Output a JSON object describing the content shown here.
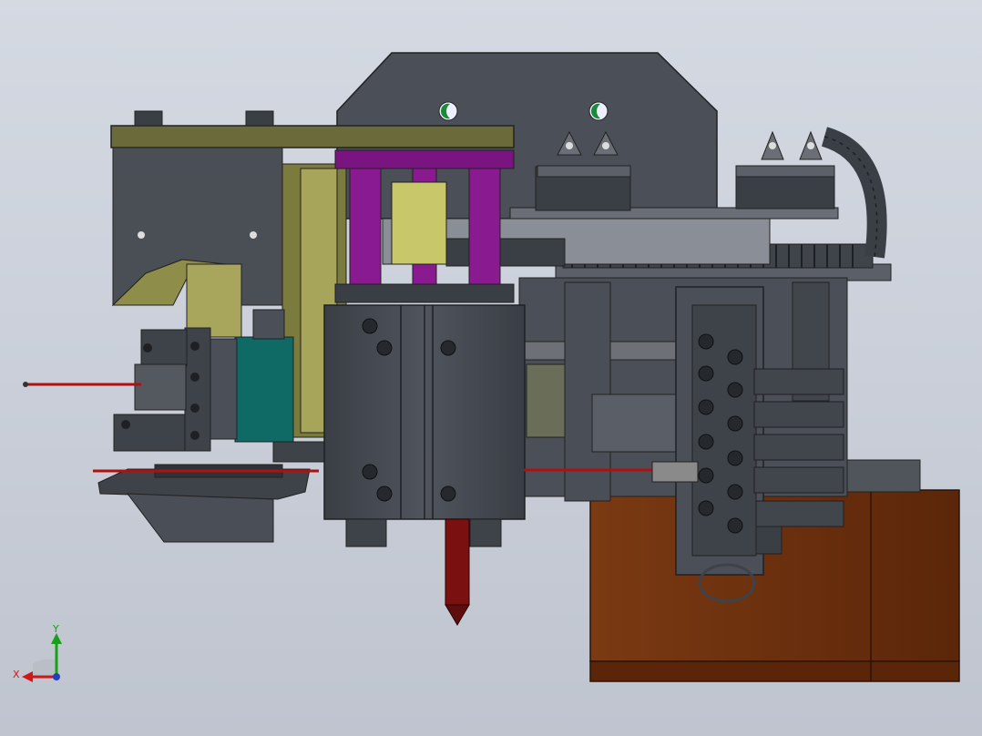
{
  "triad": {
    "x_label": "X",
    "y_label": "Y",
    "x_color": "#d01818",
    "y_color": "#18a018",
    "z_color": "#2040c0"
  },
  "colors": {
    "background": "#ccd1db",
    "dark_steel": "#3e4249",
    "mid_steel": "#555a62",
    "olive": "#6b6a3a",
    "khaki": "#a7a65c",
    "magenta": "#7a1480",
    "teal": "#0f6a66",
    "brown": "#6b2e0e",
    "red_rod": "#b01010"
  }
}
